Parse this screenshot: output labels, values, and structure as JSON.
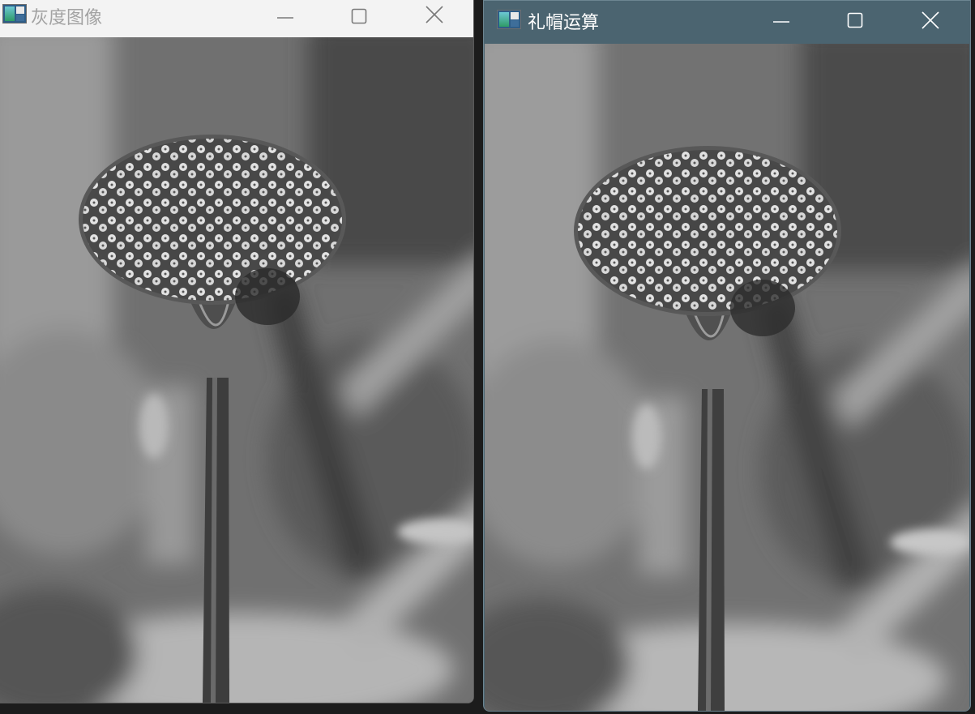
{
  "windows": [
    {
      "title": "灰度图像",
      "state": "inactive",
      "controls": [
        "minimize-icon",
        "maximize-icon",
        "close-icon"
      ]
    },
    {
      "title": "礼帽运算",
      "state": "active",
      "controls": [
        "minimize-icon",
        "maximize-icon",
        "close-icon"
      ]
    }
  ],
  "colors": {
    "inactive_titlebar": "#f3f3f3",
    "inactive_title_text": "#a3a3a3",
    "active_titlebar": "#4b6470",
    "active_title_text": "#ffffff",
    "desktop": "#1c1c1c"
  },
  "image_content": {
    "type": "grayscale-photo",
    "subject": "flower-icon"
  }
}
